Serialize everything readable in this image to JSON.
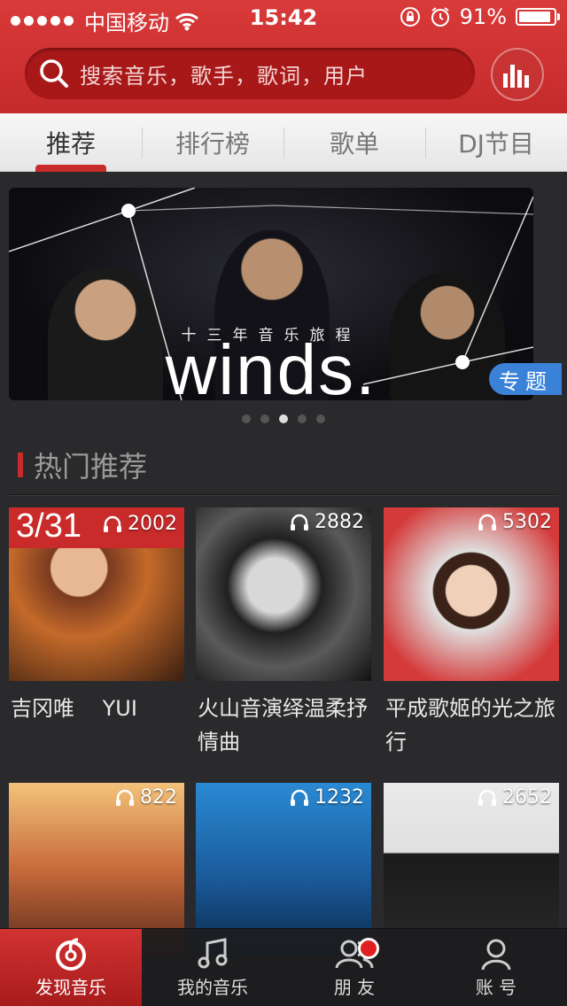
{
  "status_bar": {
    "carrier": "中国移动",
    "time": "15:42",
    "battery": "91%",
    "battery_level": 0.91
  },
  "search": {
    "placeholder": "搜索音乐，歌手，歌词，用户"
  },
  "tabs": [
    {
      "label": "推荐",
      "active": true
    },
    {
      "label": "排行榜",
      "active": false
    },
    {
      "label": "歌单",
      "active": false
    },
    {
      "label": "DJ节目",
      "active": false
    }
  ],
  "banner": {
    "subtitle": "十三年音乐旅程",
    "title": "winds.",
    "tag": "专题",
    "page_count": 5,
    "active_page": 3
  },
  "section": {
    "title": "热门推荐"
  },
  "cards": [
    {
      "date": "3/31",
      "count": "2002",
      "title": "吉冈唯　 YUI"
    },
    {
      "count": "2882",
      "title": "火山音演绎温柔抒情曲"
    },
    {
      "count": "5302",
      "title": "平成歌姬的光之旅行"
    },
    {
      "count": "822",
      "title": ""
    },
    {
      "count": "1232",
      "title": ""
    },
    {
      "count": "2652",
      "title": ""
    }
  ],
  "bottom_nav": [
    {
      "label": "发现音乐",
      "icon": "discover-music-icon",
      "active": true
    },
    {
      "label": "我的音乐",
      "icon": "music-note-icon",
      "active": false
    },
    {
      "label": "朋 友",
      "icon": "friends-icon",
      "active": false
    },
    {
      "label": "账 号",
      "icon": "account-icon",
      "active": false
    }
  ],
  "colors": {
    "brand_red": "#c92a2a",
    "tag_blue": "#3a82d8"
  }
}
